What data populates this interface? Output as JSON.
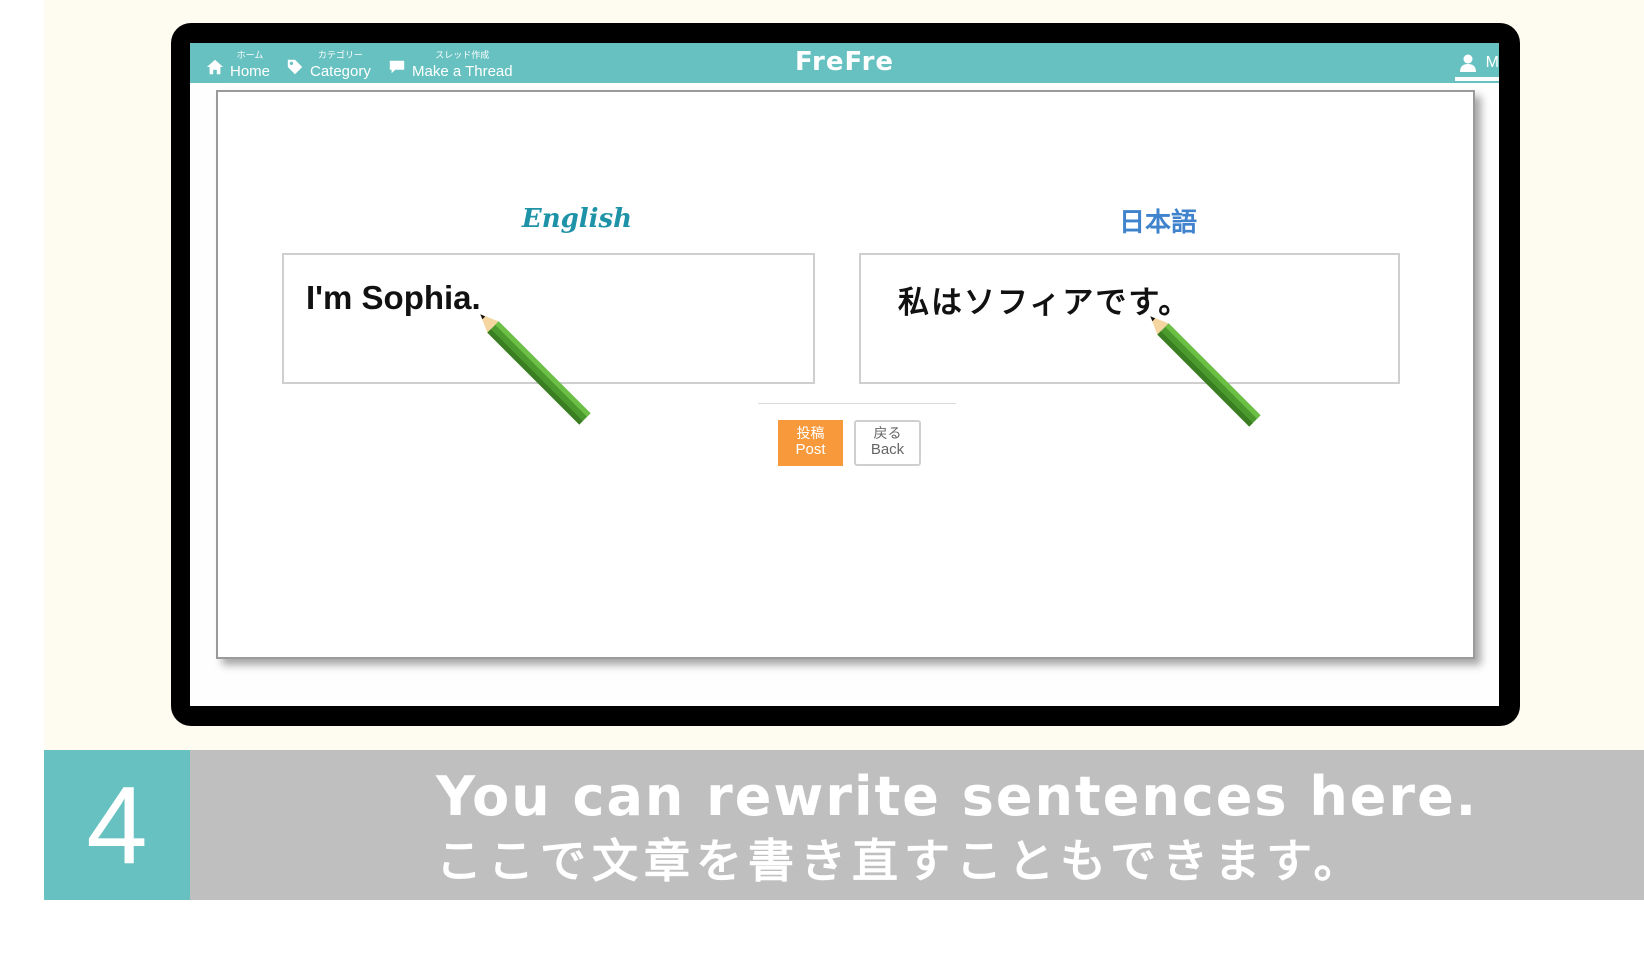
{
  "nav": {
    "home": {
      "sub": "ホーム",
      "label": "Home"
    },
    "category": {
      "sub": "カテゴリー",
      "label": "Category"
    },
    "make_thread": {
      "sub": "スレッド作成",
      "label": "Make a Thread"
    },
    "brand": "FreFre",
    "user_label": "M"
  },
  "editor": {
    "english_label": "English",
    "japanese_label": "日本語",
    "english_text": "I'm Sophia.",
    "japanese_text": "私はソフィアです。",
    "post_sub": "投稿",
    "post_label": "Post",
    "back_sub": "戻る",
    "back_label": "Back"
  },
  "caption": {
    "step": "4",
    "line1": "You can rewrite sentences here.",
    "line2": "ここで文章を書き直すこともできます。"
  },
  "icons": [
    "home-icon",
    "tag-icon",
    "speech-bubble-icon",
    "user-icon",
    "pencil-icon"
  ],
  "colors": {
    "teal": "#66c1c0",
    "orange": "#f89a3c",
    "gray_bar": "#bfbfbf",
    "cream": "#fefcf1"
  }
}
